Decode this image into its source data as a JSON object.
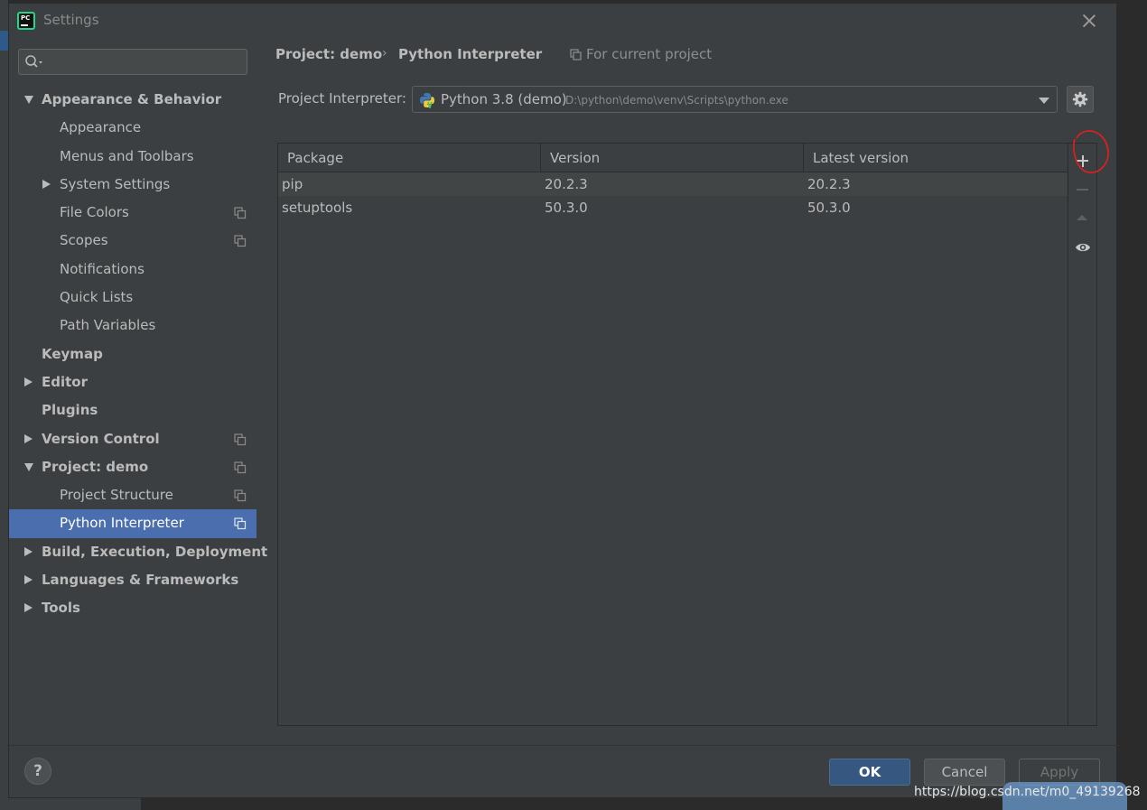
{
  "window": {
    "title": "Settings"
  },
  "search": {
    "placeholder": "",
    "value": ""
  },
  "sidebar": {
    "items": [
      {
        "label": "Appearance & Behavior",
        "level": 0,
        "bold": true,
        "expander": "down",
        "copy": false,
        "selected": false
      },
      {
        "label": "Appearance",
        "level": 1,
        "bold": false,
        "expander": "none",
        "copy": false,
        "selected": false
      },
      {
        "label": "Menus and Toolbars",
        "level": 1,
        "bold": false,
        "expander": "none",
        "copy": false,
        "selected": false
      },
      {
        "label": "System Settings",
        "level": 1,
        "bold": false,
        "expander": "right",
        "copy": false,
        "selected": false
      },
      {
        "label": "File Colors",
        "level": 1,
        "bold": false,
        "expander": "none",
        "copy": true,
        "selected": false
      },
      {
        "label": "Scopes",
        "level": 1,
        "bold": false,
        "expander": "none",
        "copy": true,
        "selected": false
      },
      {
        "label": "Notifications",
        "level": 1,
        "bold": false,
        "expander": "none",
        "copy": false,
        "selected": false
      },
      {
        "label": "Quick Lists",
        "level": 1,
        "bold": false,
        "expander": "none",
        "copy": false,
        "selected": false
      },
      {
        "label": "Path Variables",
        "level": 1,
        "bold": false,
        "expander": "none",
        "copy": false,
        "selected": false
      },
      {
        "label": "Keymap",
        "level": 0,
        "bold": true,
        "expander": "none",
        "copy": false,
        "selected": false
      },
      {
        "label": "Editor",
        "level": 0,
        "bold": true,
        "expander": "right",
        "copy": false,
        "selected": false
      },
      {
        "label": "Plugins",
        "level": 0,
        "bold": true,
        "expander": "none",
        "copy": false,
        "selected": false
      },
      {
        "label": "Version Control",
        "level": 0,
        "bold": true,
        "expander": "right",
        "copy": true,
        "selected": false
      },
      {
        "label": "Project: demo",
        "level": 0,
        "bold": true,
        "expander": "down",
        "copy": true,
        "selected": false
      },
      {
        "label": "Project Structure",
        "level": 1,
        "bold": false,
        "expander": "none",
        "copy": true,
        "selected": false
      },
      {
        "label": "Python Interpreter",
        "level": 1,
        "bold": false,
        "expander": "none",
        "copy": true,
        "selected": true
      },
      {
        "label": "Build, Execution, Deployment",
        "level": 0,
        "bold": true,
        "expander": "right",
        "copy": false,
        "selected": false
      },
      {
        "label": "Languages & Frameworks",
        "level": 0,
        "bold": true,
        "expander": "right",
        "copy": false,
        "selected": false
      },
      {
        "label": "Tools",
        "level": 0,
        "bold": true,
        "expander": "right",
        "copy": false,
        "selected": false
      }
    ]
  },
  "breadcrumb": {
    "project": "Project: demo",
    "separator": "›",
    "page": "Python Interpreter",
    "scope": "For current project"
  },
  "interpreter": {
    "label": "Project Interpreter:",
    "name": "Python 3.8 (demo)",
    "path": "D:\\python\\demo\\venv\\Scripts\\python.exe"
  },
  "packages": {
    "columns": [
      "Package",
      "Version",
      "Latest version"
    ],
    "rows": [
      [
        "pip",
        "20.2.3",
        "20.2.3"
      ],
      [
        "setuptools",
        "50.3.0",
        "50.3.0"
      ]
    ]
  },
  "buttons": {
    "help": "?",
    "ok": "OK",
    "cancel": "Cancel",
    "apply": "Apply"
  },
  "watermark": "https://blog.csdn.net/m0_49139268",
  "colors": {
    "selection": "#4b6eaf",
    "annotation": "#e0201e",
    "ok_button": "#365880",
    "app_logo_accent": "#21d789"
  }
}
